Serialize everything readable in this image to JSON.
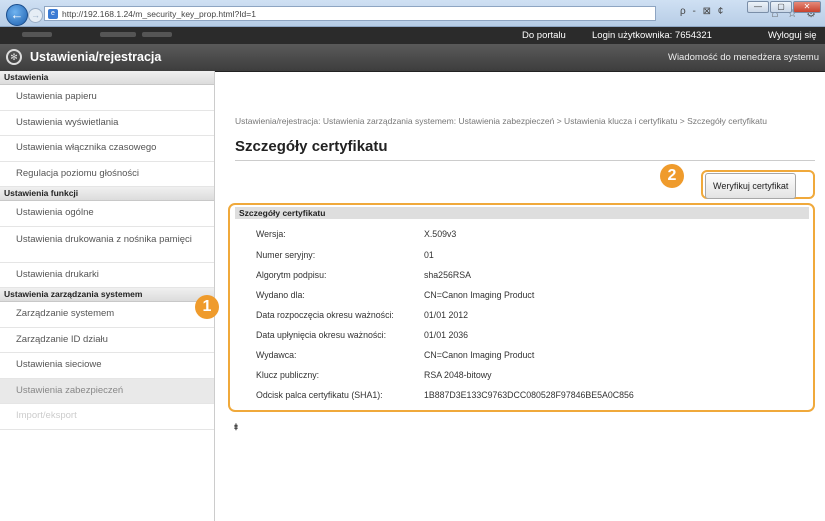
{
  "browser": {
    "url": "http://192.168.1.24/m_security_key_prop.html?Id=1",
    "search": "ρ - ⊠ ¢",
    "window_buttons": [
      "—",
      "▢",
      "✕"
    ],
    "tab_icons": "⌂ ☆ ⚙"
  },
  "topbar": {
    "portal_link": "Do portalu",
    "login_user": "Login użytkownika:  7654321",
    "logout_link": "Wyloguj się"
  },
  "titlebar": {
    "title": "Ustawienia/rejestracja",
    "message_link": "Wiadomość do menedżera systemu"
  },
  "sidebar": {
    "sections": [
      {
        "heading": "Ustawienia",
        "items": [
          "Ustawienia papieru",
          "Ustawienia wyświetlania",
          "Ustawienia włącznika czasowego",
          "Regulacja poziomu głośności"
        ]
      },
      {
        "heading": "Ustawienia funkcji",
        "items": [
          "Ustawienia ogólne",
          "Ustawienia drukowania z nośnika pamięci",
          "Ustawienia drukarki"
        ]
      },
      {
        "heading": "Ustawienia zarządzania systemem",
        "items": [
          "Zarządzanie systemem",
          "Zarządzanie ID działu",
          "Ustawienia sieciowe",
          "Ustawienia zabezpieczeń",
          "Import/eksport"
        ]
      }
    ]
  },
  "main": {
    "breadcrumb": "Ustawienia/rejestracja: Ustawienia zarządzania systemem: Ustawienia zabezpieczeń > Ustawienia klucza i certyfikatu > Szczegóły certyfikatu",
    "page_title": "Szczegóły certyfikatu",
    "verify_button": "Weryfikuj certyfikat",
    "panel_heading": "Szczegóły certyfikatu",
    "details": [
      {
        "label": "Wersja:",
        "value": "X.509v3"
      },
      {
        "label": "Numer seryjny:",
        "value": "01"
      },
      {
        "label": "Algorytm podpisu:",
        "value": "sha256RSA"
      },
      {
        "label": "Wydano dla:",
        "value": "CN=Canon Imaging Product"
      },
      {
        "label": "Data rozpoczęcia okresu ważności:",
        "value": "01/01 2012"
      },
      {
        "label": "Data upłynięcia okresu ważności:",
        "value": "01/01 2036"
      },
      {
        "label": "Wydawca:",
        "value": "CN=Canon Imaging Product"
      },
      {
        "label": "Klucz publiczny:",
        "value": "RSA 2048-bitowy"
      },
      {
        "label": "Odcisk palca certyfikatu (SHA1):",
        "value": "1B887D3E133C9763DCC080528F97846BE5A0C856"
      }
    ],
    "to_top": "⯒"
  },
  "callouts": {
    "one": "1",
    "two": "2"
  },
  "colors": {
    "accent": "#ef9b2c",
    "titlebar": "#3d3d3d"
  }
}
